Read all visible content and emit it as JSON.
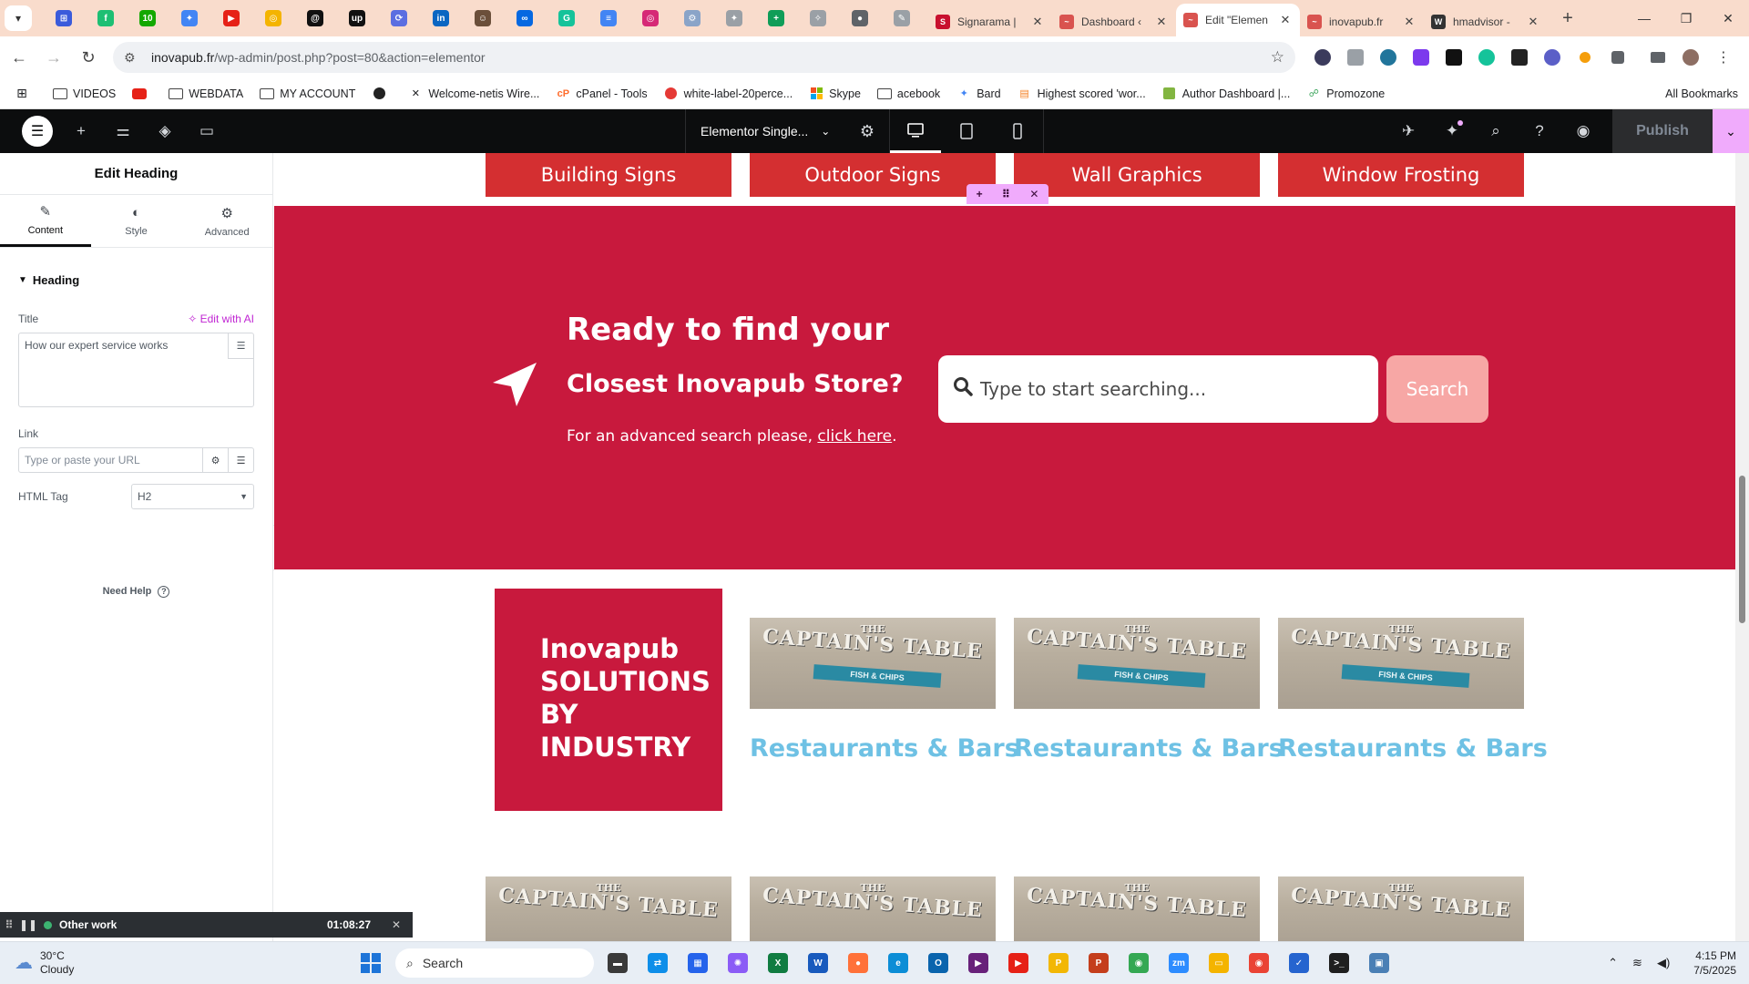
{
  "browser": {
    "pinned_icons": [
      {
        "name": "tab-grid-icon",
        "color": "#3b5bdb",
        "glyph": "⊞"
      },
      {
        "name": "fiverr-icon",
        "color": "#1dbf73",
        "glyph": "f"
      },
      {
        "name": "upwork-icon",
        "color": "#14a800",
        "glyph": "10"
      },
      {
        "name": "gemini-icon",
        "color": "#4285f4",
        "glyph": "✦"
      },
      {
        "name": "youtube-icon",
        "color": "#e62117",
        "glyph": "▶"
      },
      {
        "name": "chrome-icon",
        "color": "#f4b400",
        "glyph": "◎"
      },
      {
        "name": "threads-icon",
        "color": "#111111",
        "glyph": "@"
      },
      {
        "name": "upwork-logo-icon",
        "color": "#111111",
        "glyph": "up"
      },
      {
        "name": "sync-icon",
        "color": "#5b6ee1",
        "glyph": "⟳"
      },
      {
        "name": "linkedin-icon",
        "color": "#0a66c2",
        "glyph": "in"
      },
      {
        "name": "avatar-icon",
        "color": "#6b4f3a",
        "glyph": "☺"
      },
      {
        "name": "meta-icon",
        "color": "#0668e1",
        "glyph": "∞"
      },
      {
        "name": "grammarly-icon",
        "color": "#15c39a",
        "glyph": "G"
      },
      {
        "name": "docs-icon",
        "color": "#4285f4",
        "glyph": "≡"
      },
      {
        "name": "instagram-icon",
        "color": "#d62976",
        "glyph": "◎"
      },
      {
        "name": "gear-ext-icon",
        "color": "#8aa4c8",
        "glyph": "⚙"
      },
      {
        "name": "pin-icon",
        "color": "#9aa0a6",
        "glyph": "✦"
      },
      {
        "name": "sheets-plus-icon",
        "color": "#0f9d58",
        "glyph": "+"
      },
      {
        "name": "flow-icon",
        "color": "#9aa0a6",
        "glyph": "✧"
      },
      {
        "name": "circle-ext-icon",
        "color": "#5f6368",
        "glyph": "●"
      },
      {
        "name": "feather-icon",
        "color": "#9aa0a6",
        "glyph": "✎"
      }
    ],
    "tabs": [
      {
        "title": "Signarama |",
        "fav_color": "#c8102e",
        "fav": "S",
        "active": false
      },
      {
        "title": "Dashboard ‹",
        "fav_color": "#d9534f",
        "fav": "~",
        "active": false
      },
      {
        "title": "Edit \"Elemen",
        "fav_color": "#d9534f",
        "fav": "~",
        "active": true
      },
      {
        "title": "inovapub.fr",
        "fav_color": "#d9534f",
        "fav": "~",
        "active": false
      },
      {
        "title": "hmadvisor -",
        "fav_color": "#333333",
        "fav": "W",
        "active": false
      }
    ],
    "url_host": "inovapub.fr",
    "url_path": "/wp-admin/post.php?post=80&action=elementor",
    "bookmarks": [
      {
        "label": "VIDEOS",
        "type": "folder"
      },
      {
        "label": "",
        "type": "youtube"
      },
      {
        "label": "WEBDATA",
        "type": "folder"
      },
      {
        "label": "MY ACCOUNT",
        "type": "folder"
      },
      {
        "label": "",
        "type": "globe"
      },
      {
        "label": "Welcome-netis Wire...",
        "type": "x"
      },
      {
        "label": "cPanel - Tools",
        "type": "cpanel"
      },
      {
        "label": "white-label-20perce...",
        "type": "red"
      },
      {
        "label": "Skype",
        "type": "ms"
      },
      {
        "label": "acebook",
        "type": "folder"
      },
      {
        "label": "Bard",
        "type": "bard"
      },
      {
        "label": "Highest scored 'wor...",
        "type": "so"
      },
      {
        "label": "Author Dashboard |...",
        "type": "green"
      },
      {
        "label": "Promozone",
        "type": "promo"
      }
    ],
    "all_bookmarks_label": "All Bookmarks"
  },
  "elementor": {
    "document_title": "Elementor Single...",
    "publish_label": "Publish",
    "panel": {
      "title": "Edit Heading",
      "tabs": [
        {
          "label": "Content",
          "icon": "✎"
        },
        {
          "label": "Style",
          "icon": "◐"
        },
        {
          "label": "Advanced",
          "icon": "⚙"
        }
      ],
      "section": "Heading",
      "title_label": "Title",
      "edit_ai_label": "Edit with AI",
      "title_value": "How our expert service works",
      "link_label": "Link",
      "link_placeholder": "Type or paste your URL",
      "html_tag_label": "HTML Tag",
      "html_tag_value": "H2",
      "need_help": "Need Help"
    }
  },
  "page": {
    "categories": [
      "Building Signs",
      "Outdoor Signs",
      "Wall Graphics",
      "Window Frosting"
    ],
    "promo": {
      "heading": "Ready to find your",
      "subheading": "Closest Inovapub Store?",
      "text": "For an advanced search please,",
      "link": "click here",
      "period": ".",
      "search_placeholder": "Type to start searching...",
      "search_button": "Search"
    },
    "solutions": [
      "Inovapub",
      "SOLUTIONS",
      "BY",
      "INDUSTRY"
    ],
    "thumb_logo_small": "THE",
    "thumb_logo_big": "CAPTAIN'S TABLE",
    "thumb_ribbon": "FISH & CHIPS",
    "industries": [
      "Restaurants & Bars",
      "Restaurants & Bars",
      "Restaurants & Bars"
    ]
  },
  "timer": {
    "label": "Other work",
    "time": "01:08:27"
  },
  "taskbar": {
    "temp": "30°C",
    "condition": "Cloudy",
    "search_label": "Search",
    "time": "4:15 PM",
    "date": "7/5/2025",
    "apps": [
      {
        "name": "file-manager-icon",
        "color": "#3a3a3a",
        "glyph": "▬"
      },
      {
        "name": "teamviewer-icon",
        "color": "#0e8ee9",
        "glyph": "⇄"
      },
      {
        "name": "store-icon",
        "color": "#2563eb",
        "glyph": "▦"
      },
      {
        "name": "copilot-icon",
        "color": "#8b5cf6",
        "glyph": "✺"
      },
      {
        "name": "excel-icon",
        "color": "#107c41",
        "glyph": "X"
      },
      {
        "name": "word-icon",
        "color": "#185abd",
        "glyph": "W"
      },
      {
        "name": "firefox-icon",
        "color": "#ff7139",
        "glyph": "●"
      },
      {
        "name": "edge-icon",
        "color": "#0c8dd6",
        "glyph": "e"
      },
      {
        "name": "outlook-icon",
        "color": "#0a64ad",
        "glyph": "O"
      },
      {
        "name": "vs-icon",
        "color": "#68217a",
        "glyph": "▶"
      },
      {
        "name": "youtube-app-icon",
        "color": "#e62117",
        "glyph": "▶"
      },
      {
        "name": "payoneer-icon",
        "color": "#f2b705",
        "glyph": "P"
      },
      {
        "name": "powerpoint-icon",
        "color": "#c43e1c",
        "glyph": "P"
      },
      {
        "name": "chrome-app-icon",
        "color": "#34a853",
        "glyph": "◉"
      },
      {
        "name": "zoom-icon",
        "color": "#2d8cff",
        "glyph": "zm"
      },
      {
        "name": "explorer-icon",
        "color": "#f4b400",
        "glyph": "▭"
      },
      {
        "name": "chrome-active-icon",
        "color": "#ea4335",
        "glyph": "◉"
      },
      {
        "name": "todo-icon",
        "color": "#2564cf",
        "glyph": "✓"
      },
      {
        "name": "terminal-icon",
        "color": "#1f1f1f",
        "glyph": ">_"
      },
      {
        "name": "network-app-icon",
        "color": "#4a7fb5",
        "glyph": "▣"
      }
    ]
  },
  "colors": {
    "promo_bg": "#c8193d",
    "category_bg": "#d42f31",
    "industry_label": "#6ec1e4",
    "search_button_bg": "#f7a7a5",
    "elementor_accent": "#f0abfc"
  }
}
